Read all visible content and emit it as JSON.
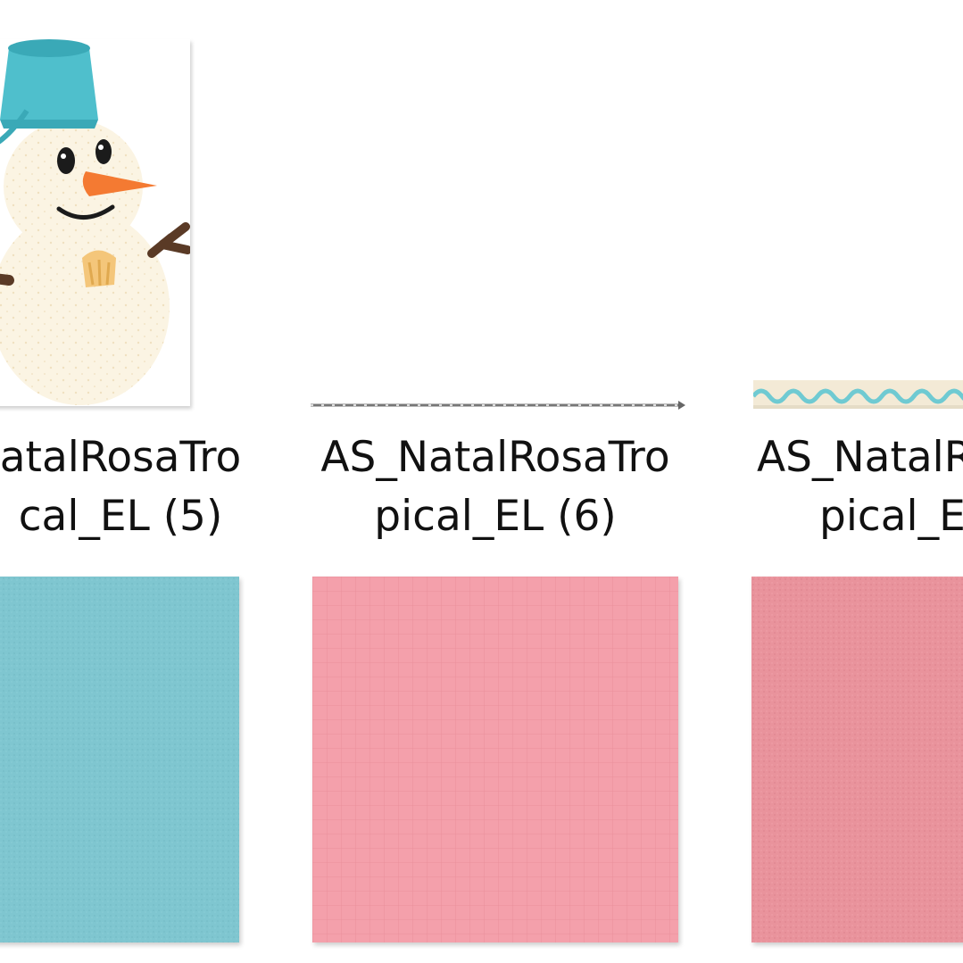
{
  "files": [
    {
      "name_line1": "atalRosaTro",
      "name_line2": "cal_EL (5)",
      "thumbnail": "snowman-illustration"
    },
    {
      "name_line1": "AS_NatalRosaTro",
      "name_line2": "pical_EL (6)",
      "thumbnail": "thin-dotted-strip"
    },
    {
      "name_line1": "AS_NatalR",
      "name_line2": "pical_E",
      "thumbnail": "wave-ribbon"
    }
  ],
  "papers": [
    {
      "thumbnail": "teal-paper",
      "color": "#7fc6d0"
    },
    {
      "thumbnail": "pink-grid-paper",
      "color": "#f4a0ab"
    },
    {
      "thumbnail": "rose-paper",
      "color": "#e9939c"
    }
  ],
  "colors": {
    "snowman_hat": "#4fbfcc",
    "snowman_body": "#fbf4e3",
    "carrot": "#f47a32",
    "wave": "#6fcad2",
    "ribbon_bg": "#f3ead6"
  }
}
